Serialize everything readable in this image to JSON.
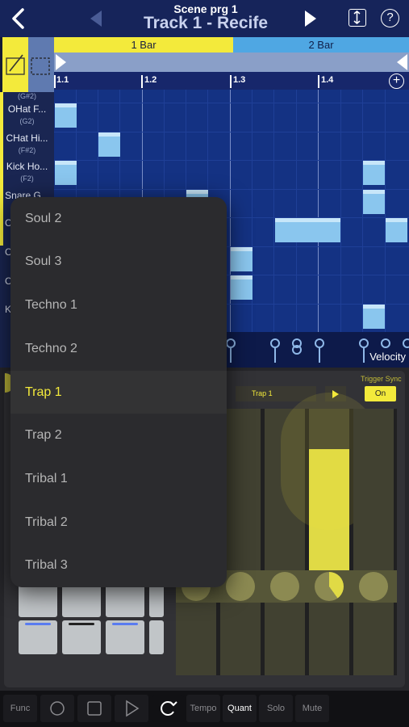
{
  "header": {
    "scene_label": "Scene  prg 1",
    "track_title": "Track 1 - Recife",
    "back_icon": "chevron-left-icon",
    "prev_icon": "triangle-left-icon",
    "next_icon": "triangle-right-icon",
    "resize_icon": "vertical-resize-icon",
    "help_label": "?"
  },
  "bars": {
    "bar1": "1 Bar",
    "bar2": "2 Bar"
  },
  "ruler": {
    "marks": [
      "1.1",
      "1.2",
      "1.3",
      "1.4"
    ],
    "add_label": "+"
  },
  "tracks": [
    {
      "name": "",
      "note": "(G#2)"
    },
    {
      "name": "OHat F...",
      "note": "(G2)"
    },
    {
      "name": "CHat Hi...",
      "note": "(F#2)"
    },
    {
      "name": "Kick Ho...",
      "note": "(F2)"
    },
    {
      "name": "Snare G...",
      "note": ""
    },
    {
      "name": "C",
      "note": ""
    },
    {
      "name": "C",
      "note": ""
    },
    {
      "name": "C",
      "note": ""
    },
    {
      "name": "K",
      "note": ""
    }
  ],
  "velocity": {
    "label": "Velocity"
  },
  "dropdown": {
    "items": [
      "Soul 2",
      "Soul 3",
      "Techno 1",
      "Techno 2",
      "Trap 1",
      "Trap 2",
      "Tribal 1",
      "Tribal 2",
      "Tribal 3"
    ],
    "selected": "Trap 1"
  },
  "fx": {
    "trigger_sync_label": "Trigger Sync",
    "preset_value": "Trap 1",
    "on_label": "On"
  },
  "bottom_bar": {
    "func": "Func",
    "tempo": "Tempo",
    "quant": "Quant",
    "solo": "Solo",
    "mute": "Mute"
  },
  "colors": {
    "accent_yellow": "#f3ea3b",
    "grid_blue": "#143283",
    "note_blue": "#8ac6ee",
    "header_blue": "#16245a"
  }
}
